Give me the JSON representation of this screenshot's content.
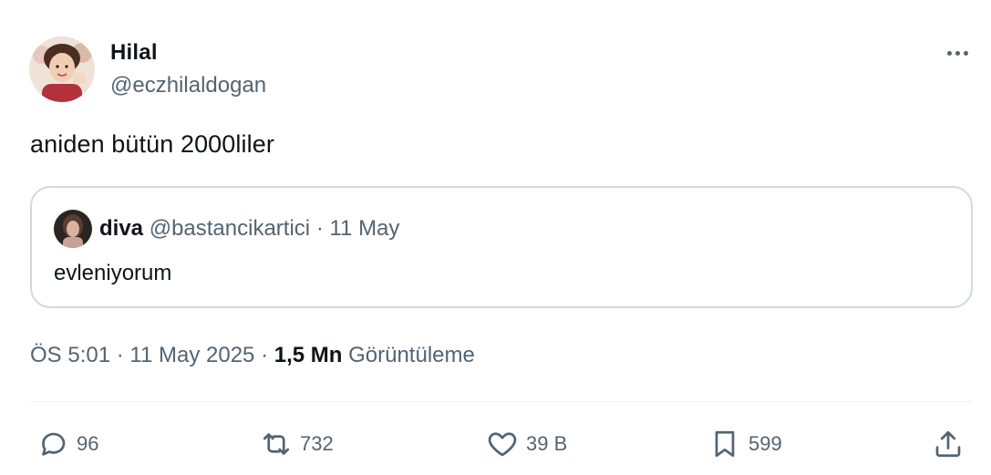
{
  "author": {
    "display_name": "Hilal",
    "handle": "@eczhilaldogan"
  },
  "tweet": {
    "text": "aniden bütün 2000liler"
  },
  "quoted_tweet": {
    "display_name": "diva",
    "handle": "@bastancikartici",
    "separator": "·",
    "date": "11 May",
    "text": "evleniyorum"
  },
  "meta": {
    "time": "ÖS 5:01",
    "separator": "·",
    "date": "11 May 2025",
    "separator2": "·",
    "views_count": "1,5 Mn",
    "views_label": "Görüntüleme"
  },
  "actions": {
    "reply_count": "96",
    "retweet_count": "732",
    "like_count": "39 B",
    "bookmark_count": "599"
  },
  "icons": {
    "more": "more-horizontal-icon",
    "reply": "reply-icon",
    "retweet": "retweet-icon",
    "like": "heart-icon",
    "bookmark": "bookmark-icon",
    "share": "share-icon"
  },
  "colors": {
    "text_primary": "#0f1419",
    "text_secondary": "#536471",
    "border": "#cfd9de"
  }
}
